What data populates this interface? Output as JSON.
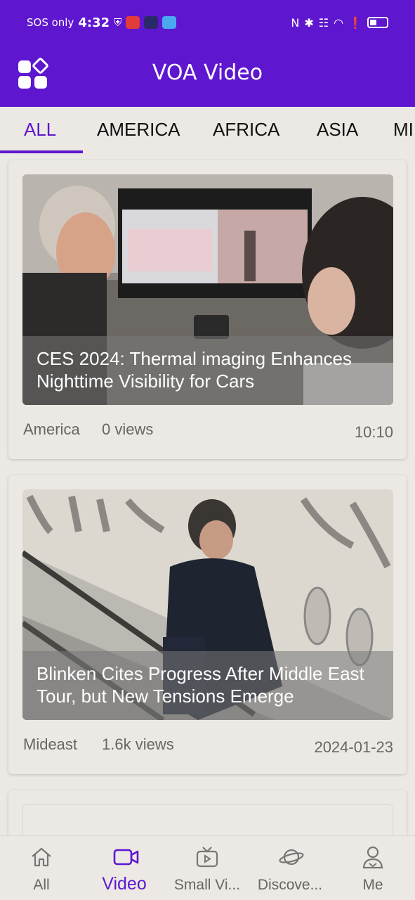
{
  "status_bar": {
    "carrier": "SOS only",
    "time": "4:32"
  },
  "app": {
    "title": "VOA Video"
  },
  "tabs": [
    {
      "label": "ALL",
      "active": true
    },
    {
      "label": "AMERICA"
    },
    {
      "label": "AFRICA"
    },
    {
      "label": "ASIA"
    },
    {
      "label": "MI"
    }
  ],
  "feed": [
    {
      "title": "CES 2024: Thermal imaging Enhances Nighttime Visibility for Cars",
      "category": "America",
      "views": "0 views",
      "stamp": "10:10"
    },
    {
      "title": "Blinken Cites Progress After Middle East Tour, but New Tensions Emerge",
      "category": "Mideast",
      "views": "1.6k views",
      "stamp": "2024-01-23"
    }
  ],
  "bottom_nav": [
    {
      "label": "All",
      "icon": "home-icon"
    },
    {
      "label": "Video",
      "icon": "video-camera-icon",
      "active": true
    },
    {
      "label": "Small Vi...",
      "icon": "tv-icon"
    },
    {
      "label": "Discove...",
      "icon": "planet-icon"
    },
    {
      "label": "Me",
      "icon": "user-icon"
    }
  ],
  "colors": {
    "accent": "#5e17cf",
    "background": "#ece9e4"
  }
}
